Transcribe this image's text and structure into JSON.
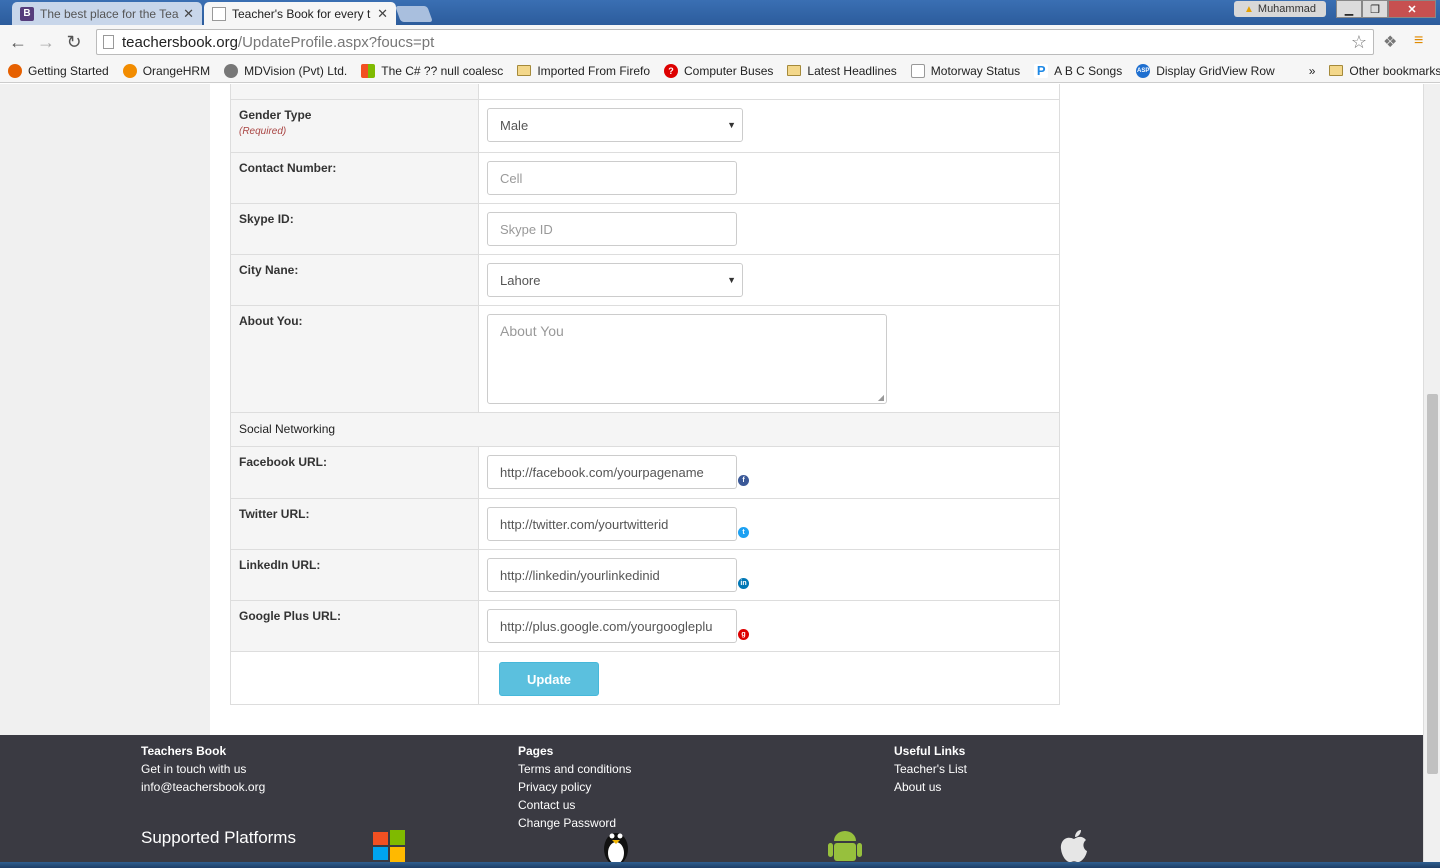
{
  "browser": {
    "tabs": [
      {
        "title": "The best place for the Tea",
        "favicon": "B"
      },
      {
        "title": "Teacher's Book for every t",
        "favicon": "page-icon"
      }
    ],
    "user_name": "Muhammad",
    "url_host": "teachersbook.org",
    "url_path": "/UpdateProfile.aspx?foucs=pt",
    "bookmarks": [
      {
        "label": "Getting Started",
        "icon": "firefox-icon"
      },
      {
        "label": "OrangeHRM",
        "icon": "orangehrm-icon"
      },
      {
        "label": "MDVision (Pvt) Ltd.",
        "icon": "mdvision-icon"
      },
      {
        "label": "The C# ?? null coalesc",
        "icon": "stackexchange-icon"
      },
      {
        "label": "Imported From Firefo",
        "icon": "folder-icon"
      },
      {
        "label": "Computer Buses",
        "icon": "question-icon"
      },
      {
        "label": "Latest Headlines",
        "icon": "folder-icon"
      },
      {
        "label": "Motorway Status",
        "icon": "page-icon"
      },
      {
        "label": "A B C Songs",
        "icon": "p-icon"
      },
      {
        "label": "Display GridView Row",
        "icon": "asp-icon"
      }
    ],
    "overflow": "»",
    "other_bookmarks": "Other bookmarks"
  },
  "form": {
    "gender": {
      "label": "Gender Type",
      "required": "(Required)",
      "value": "Male"
    },
    "contact": {
      "label": "Contact Number:",
      "placeholder": "Cell"
    },
    "skype": {
      "label": "Skype ID:",
      "placeholder": "Skype ID"
    },
    "city": {
      "label": "City Nane:",
      "value": "Lahore"
    },
    "about": {
      "label": "About You:",
      "placeholder": "About You"
    },
    "social_heading": "Social Networking",
    "facebook": {
      "label": "Facebook URL:",
      "value": "http://facebook.com/yourpagename",
      "icon_color": "#3b5998"
    },
    "twitter": {
      "label": "Twitter URL:",
      "value": "http://twitter.com/yourtwitterid",
      "icon_color": "#1da1f2"
    },
    "linkedin": {
      "label": "LinkedIn URL:",
      "value": "http://linkedin/yourlinkedinid",
      "icon_color": "#0077b5"
    },
    "googleplus": {
      "label": "Google Plus URL:",
      "value": "http://plus.google.com/yourgoogleplu",
      "icon_color": "#dd0000"
    },
    "update_button": "Update"
  },
  "footer": {
    "col1": {
      "heading": "Teachers Book",
      "items": [
        "Get in touch with us",
        "info@teachersbook.org"
      ]
    },
    "col2": {
      "heading": "Pages",
      "items": [
        "Terms and conditions",
        "Privacy policy",
        "Contact us",
        "Change Password"
      ]
    },
    "col3": {
      "heading": "Useful Links",
      "items": [
        "Teacher's List",
        "About us"
      ]
    },
    "supported": "Supported Platforms",
    "platforms": [
      "windows-icon",
      "linux-icon",
      "android-icon",
      "apple-icon"
    ]
  }
}
